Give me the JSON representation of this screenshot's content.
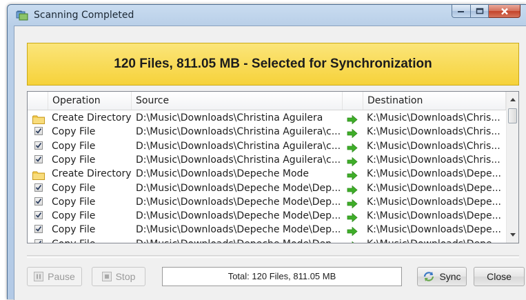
{
  "window": {
    "title": "Scanning Completed"
  },
  "banner": {
    "text": "120 Files, 811.05 MB - Selected for Synchronization"
  },
  "table": {
    "columns": [
      "Operation",
      "Source",
      "Destination"
    ],
    "rows": [
      {
        "type": "folder",
        "operation": "Create Directory",
        "source": "D:\\Music\\Downloads\\Christina Aguilera",
        "destination": "K:\\Music\\Downloads\\Chris..."
      },
      {
        "type": "file",
        "checked": true,
        "operation": "Copy File",
        "source": "D:\\Music\\Downloads\\Christina Aguilera\\c...",
        "destination": "K:\\Music\\Downloads\\Chris..."
      },
      {
        "type": "file",
        "checked": true,
        "operation": "Copy File",
        "source": "D:\\Music\\Downloads\\Christina Aguilera\\c...",
        "destination": "K:\\Music\\Downloads\\Chris..."
      },
      {
        "type": "file",
        "checked": true,
        "operation": "Copy File",
        "source": "D:\\Music\\Downloads\\Christina Aguilera\\c...",
        "destination": "K:\\Music\\Downloads\\Chris..."
      },
      {
        "type": "folder",
        "operation": "Create Directory",
        "source": "D:\\Music\\Downloads\\Depeche Mode",
        "destination": "K:\\Music\\Downloads\\Depe..."
      },
      {
        "type": "file",
        "checked": true,
        "operation": "Copy File",
        "source": "D:\\Music\\Downloads\\Depeche Mode\\Dep...",
        "destination": "K:\\Music\\Downloads\\Depe..."
      },
      {
        "type": "file",
        "checked": true,
        "operation": "Copy File",
        "source": "D:\\Music\\Downloads\\Depeche Mode\\Dep...",
        "destination": "K:\\Music\\Downloads\\Depe..."
      },
      {
        "type": "file",
        "checked": true,
        "operation": "Copy File",
        "source": "D:\\Music\\Downloads\\Depeche Mode\\Dep...",
        "destination": "K:\\Music\\Downloads\\Depe..."
      },
      {
        "type": "file",
        "checked": true,
        "operation": "Copy File",
        "source": "D:\\Music\\Downloads\\Depeche Mode\\Dep...",
        "destination": "K:\\Music\\Downloads\\Depe..."
      },
      {
        "type": "file",
        "checked": true,
        "operation": "Copy File",
        "source": "D:\\Music\\Downloads\\Depeche Mode\\Dep...",
        "destination": "K:\\Music\\Downloads\\Depe..."
      }
    ]
  },
  "buttons": {
    "pause": "Pause",
    "stop": "Stop",
    "sync": "Sync",
    "close": "Close"
  },
  "status": {
    "total": "Total: 120 Files, 811.05 MB"
  },
  "colors": {
    "banner": "#f6d23a",
    "arrow": "#3fae29",
    "folder": "#f2c94c"
  }
}
